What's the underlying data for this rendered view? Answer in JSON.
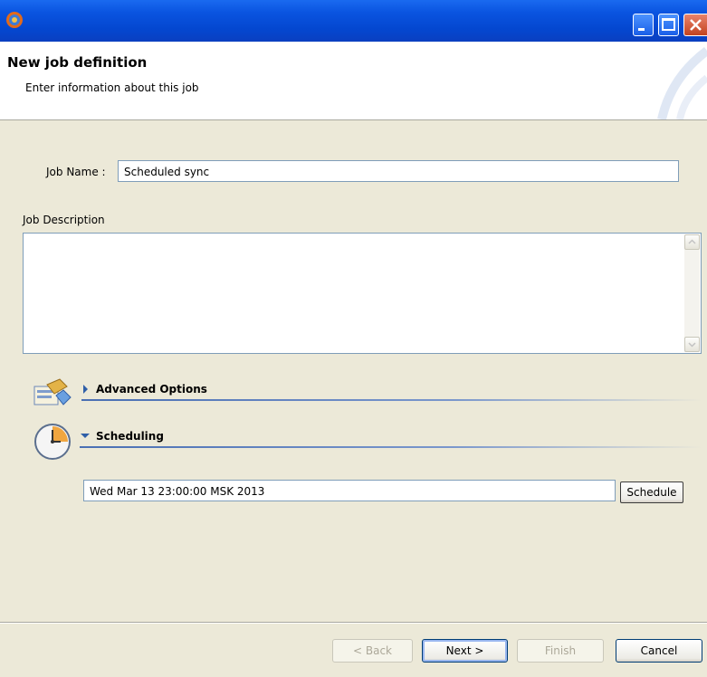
{
  "header": {
    "title": "New job definition",
    "subtitle": "Enter information about this job"
  },
  "form": {
    "job_name_label": "Job Name :",
    "job_name_value": "Scheduled sync",
    "job_description_label": "Job Description",
    "job_description_value": ""
  },
  "sections": {
    "advanced_options": {
      "label": "Advanced Options",
      "expanded": false
    },
    "scheduling": {
      "label": "Scheduling",
      "expanded": true
    }
  },
  "scheduling": {
    "date_value": "Wed Mar 13 23:00:00 MSK 2013",
    "schedule_button": "Schedule"
  },
  "footer": {
    "back_button": "< Back",
    "next_button": "Next >",
    "finish_button": "Finish",
    "cancel_button": "Cancel"
  },
  "colors": {
    "titlebar": "#0a54e0",
    "dialog_bg": "#ece9d8",
    "section_line": "#4a6fb3"
  }
}
